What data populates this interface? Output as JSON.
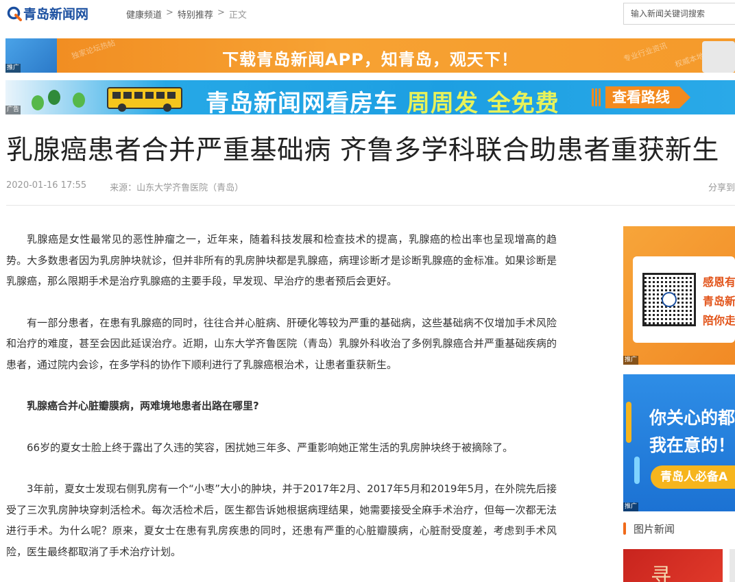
{
  "header": {
    "logo_text": "青岛新闻网",
    "breadcrumb": [
      "健康频道",
      "特别推荐",
      "正文"
    ],
    "breadcrumb_sep": ">",
    "search_placeholder": "输入新闻关键词搜索"
  },
  "banners": {
    "app_text": "下载青岛新闻APP，知青岛，观天下！",
    "app_tag": "推广",
    "app_faint_left": "独家论坛热帖",
    "app_faint_right": "专业行业资讯",
    "app_faint_right2": "权威本地新闻",
    "house_main": "青岛新闻网看房车",
    "house_accent": "周周发 全免费",
    "house_button": "查看路线",
    "house_tag": "广告"
  },
  "article": {
    "title": "乳腺癌患者合并严重基础病 齐鲁多学科联合助患者重获新生",
    "datetime": "2020-01-16 17:55",
    "source": "来源：山东大学齐鲁医院（青岛）",
    "share": "分享到",
    "paragraphs": [
      "乳腺癌是女性最常见的恶性肿瘤之一，近年来，随着科技发展和检查技术的提高，乳腺癌的检出率也呈现增高的趋势。大多数患者因为乳房肿块就诊，但并非所有的乳房肿块都是乳腺癌，病理诊断才是诊断乳腺癌的金标准。如果诊断是乳腺癌，那么限期手术是治疗乳腺癌的主要手段，早发现、早治疗的患者预后会更好。",
      "有一部分患者，在患有乳腺癌的同时，往往合并心脏病、肝硬化等较为严重的基础病，这些基础病不仅增加手术风险和治疗的难度，甚至会因此延误治疗。近期，山东大学齐鲁医院（青岛）乳腺外科收治了多例乳腺癌合并严重基础疾病的患者，通过院内会诊，在多学科的协作下顺利进行了乳腺癌根治术，让患者重获新生。",
      "乳腺癌合并心脏瓣膜病，两难境地患者出路在哪里?",
      "66岁的夏女士脸上终于露出了久违的笑容，困扰她三年多、严重影响她正常生活的乳房肿块终于被摘除了。",
      "3年前，夏女士发现右侧乳房有一个“小枣”大小的肿块，并于2017年2月、2017年5月和2019年5月，在外院先后接受了三次乳房肿块穿刺活检术。每次活检术后，医生都告诉她根据病理结果，她需要接受全麻手术治疗，但每一次都无法进行手术。为什么呢？原来，夏女士在患有乳房疾患的同时，还患有严重的心脏瓣膜病，心脏耐受度差，考虑到手术风险，医生最终都取消了手术治疗计划。"
    ]
  },
  "sidebar": {
    "ad1_lines": [
      "感恩有",
      "青岛新",
      "陪你走"
    ],
    "ad1_tag": "推广",
    "ad2_lines": [
      "你关心的都",
      "我在意的！"
    ],
    "ad2_pill": "青岛人必备A",
    "ad2_tag": "推广",
    "section_label": "图片新闻",
    "thumb_glyph": "寻"
  },
  "colors": {
    "brand_blue": "#1a4fa0",
    "accent_orange": "#f06a1a",
    "banner_orange": "#f08a1f",
    "banner_blue": "#1d9fe2"
  }
}
